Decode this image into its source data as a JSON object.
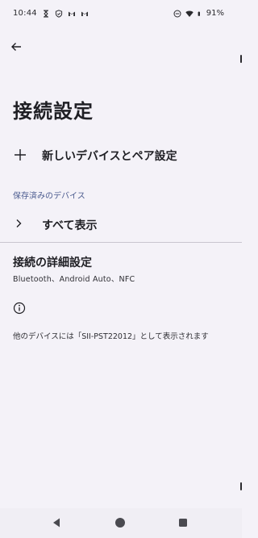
{
  "status_bar": {
    "time": "10:44",
    "battery_percent": "91%"
  },
  "page": {
    "title": "接続設定"
  },
  "pair_new_device": {
    "label": "新しいデバイスとペア設定"
  },
  "saved_devices": {
    "header": "保存済みのデバイス",
    "show_all_label": "すべて表示"
  },
  "advanced": {
    "title": "接続の詳細設定",
    "summary": "Bluetooth、Android Auto、NFC"
  },
  "device_name_note": "他のデバイスには「SII-PST22012」として表示されます",
  "icons": {
    "back": "arrow-back-icon",
    "add": "plus-icon",
    "show_all": "chevron-right-icon",
    "info": "info-icon"
  },
  "colors": {
    "background": "#f4f2f8",
    "section_header": "#4a5a8e",
    "text": "#1f1f24"
  }
}
